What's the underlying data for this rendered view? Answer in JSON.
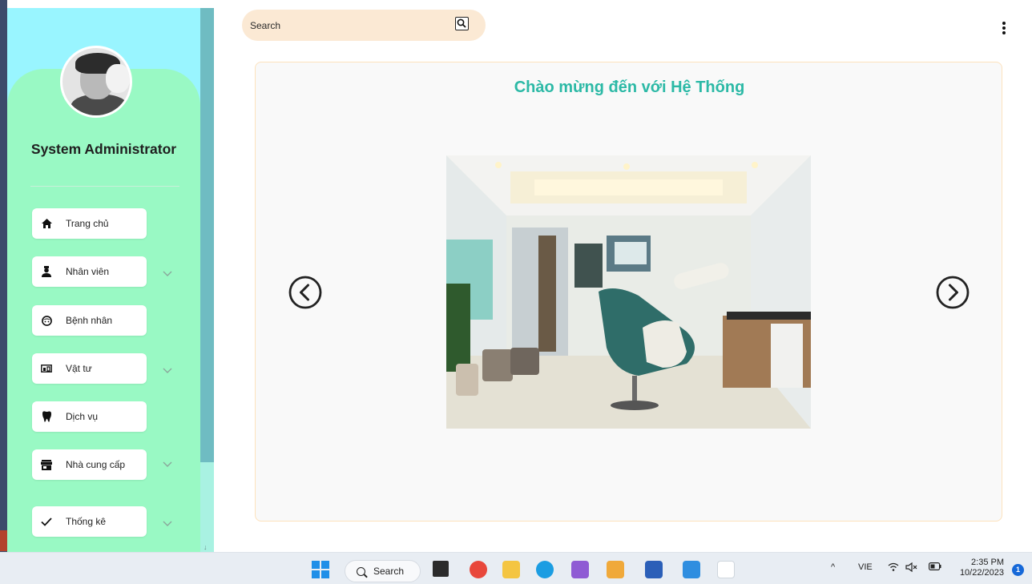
{
  "sidebar": {
    "user_name": "System Administrator",
    "items": [
      {
        "label": "Trang chủ",
        "icon": "home-icon",
        "expandable": false
      },
      {
        "label": "Nhân viên",
        "icon": "staff-icon",
        "expandable": true
      },
      {
        "label": "Bệnh nhân",
        "icon": "patient-icon",
        "expandable": false
      },
      {
        "label": "Vật tư",
        "icon": "supplies-icon",
        "expandable": true
      },
      {
        "label": "Dịch vụ",
        "icon": "tooth-icon",
        "expandable": false
      },
      {
        "label": "Nhà cung cấp",
        "icon": "store-icon",
        "expandable": true
      },
      {
        "label": "Thống kê",
        "icon": "check-icon",
        "expandable": true
      }
    ]
  },
  "header": {
    "search_placeholder": "Search"
  },
  "main": {
    "title": "Chào mừng đến với Hệ Thống",
    "carousel": {
      "prev": "chevron-left-circle-icon",
      "next": "chevron-right-circle-icon"
    }
  },
  "taskbar": {
    "search_label": "Search",
    "language": "VIE",
    "time": "2:35 PM",
    "date": "10/22/2023",
    "notification_count": "1"
  },
  "colors": {
    "sidebar_top": "#99f5ff",
    "sidebar_panel": "#99f9c4",
    "title": "#2cb9a6",
    "search_bg": "#fbe9d4",
    "card_border": "#fde2bd"
  }
}
